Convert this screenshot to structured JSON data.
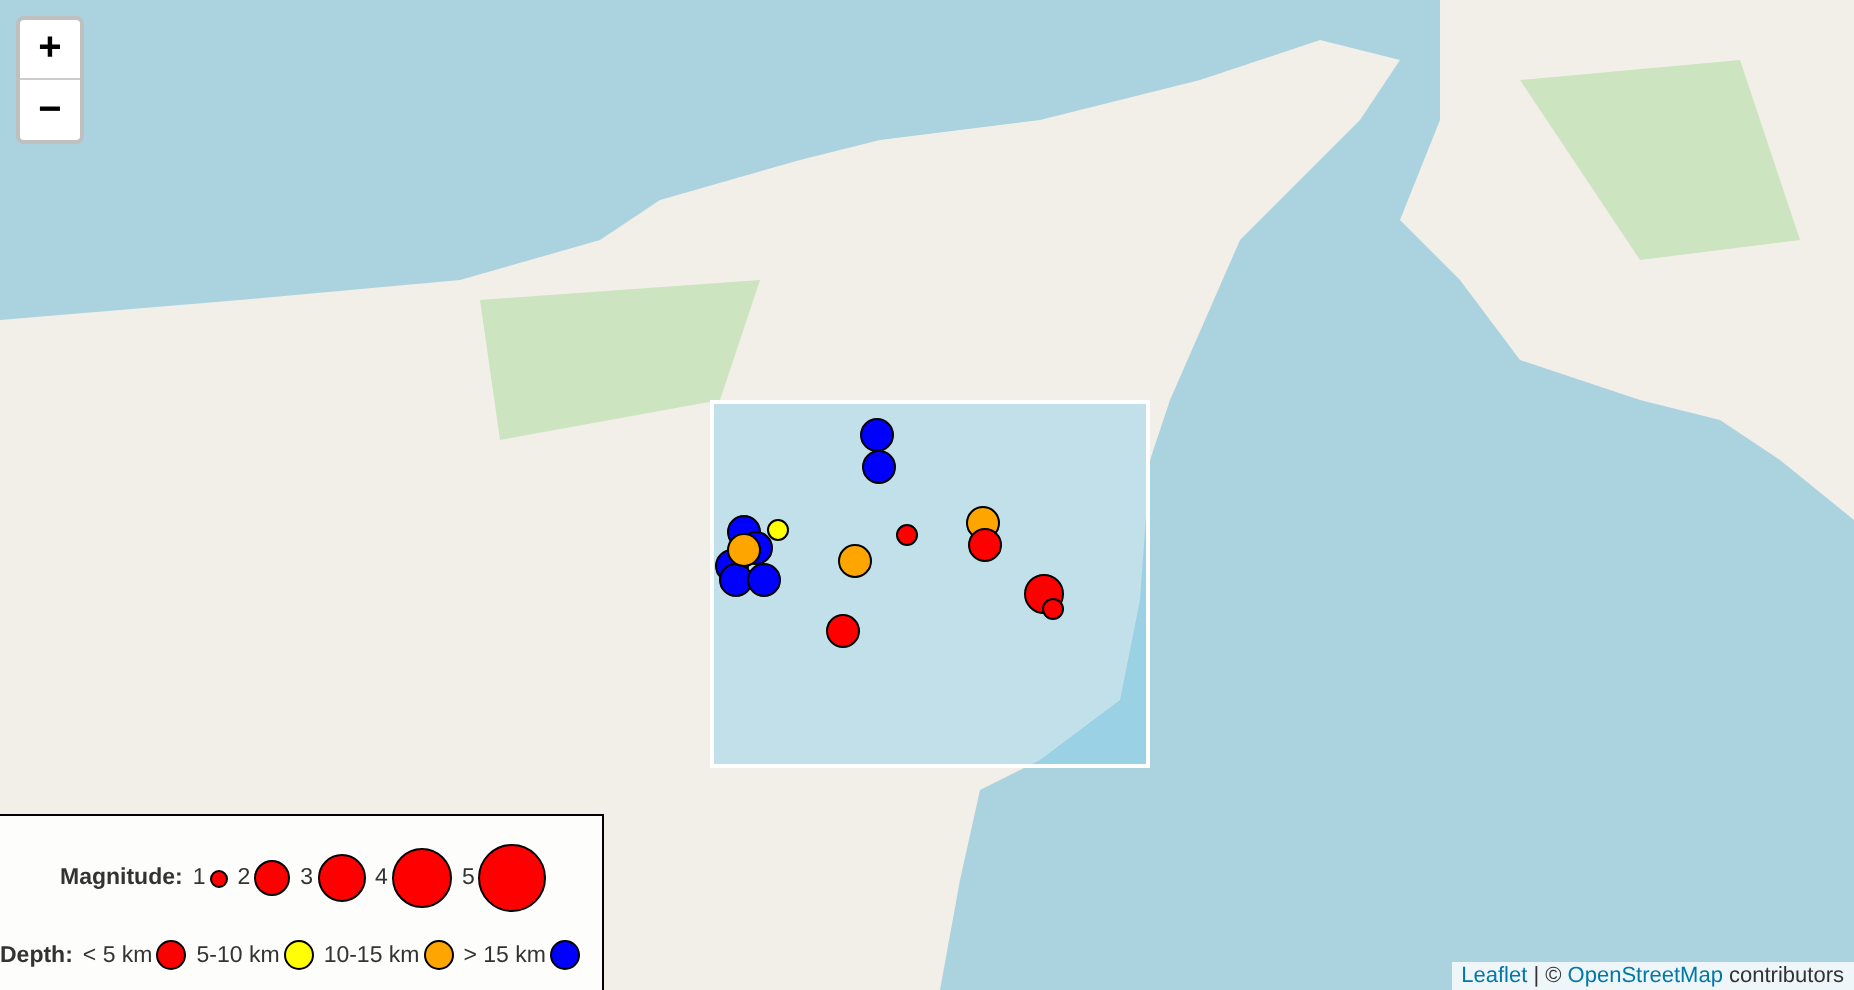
{
  "zoom_controls": {
    "zoom_in": "+",
    "zoom_out": "−"
  },
  "map": {
    "highlight_area": true,
    "quakes": [
      {
        "kind": "medium",
        "color": "#0000ff"
      },
      {
        "kind": "medium",
        "color": "#0000ff"
      },
      {
        "kind": "cluster",
        "markers": [
          {
            "kind": "small",
            "color": "#ffff00"
          },
          {
            "kind": "medium",
            "color": "#0000ff"
          },
          {
            "kind": "medium",
            "color": "#0000ff"
          },
          {
            "kind": "medium",
            "color": "#0000ff"
          },
          {
            "kind": "medium",
            "color": "#0000ff"
          },
          {
            "kind": "medium",
            "color": "#0000ff"
          },
          {
            "kind": "medium",
            "color": "#ffa500"
          }
        ]
      },
      {
        "kind": "small",
        "color": "#ff0000"
      },
      {
        "kind": "medium",
        "color": "#ffa500"
      },
      {
        "kind": "medium",
        "color": "#ffa500"
      },
      {
        "kind": "medium",
        "color": "#ff0000"
      },
      {
        "kind": "large",
        "color": "#ff0000"
      },
      {
        "kind": "small",
        "color": "#ff0000"
      },
      {
        "kind": "medium",
        "color": "#ff0000"
      }
    ]
  },
  "legend": {
    "magnitude_label": "Magnitude:",
    "magnitudes": [
      "1",
      "2",
      "3",
      "4",
      "5"
    ],
    "depth_label": "Depth:",
    "depths": [
      {
        "label": "< 5 km",
        "color": "#ff0000"
      },
      {
        "label": "5-10 km",
        "color": "#ffff00"
      },
      {
        "label": "10-15 km",
        "color": "#ffa500"
      },
      {
        "label": "> 15 km",
        "color": "#0000ff"
      }
    ]
  },
  "attribution": {
    "link_1": "Leaflet",
    "separator": "| ©",
    "link_2": "OpenStreetMap",
    "suffix": "contributors"
  }
}
